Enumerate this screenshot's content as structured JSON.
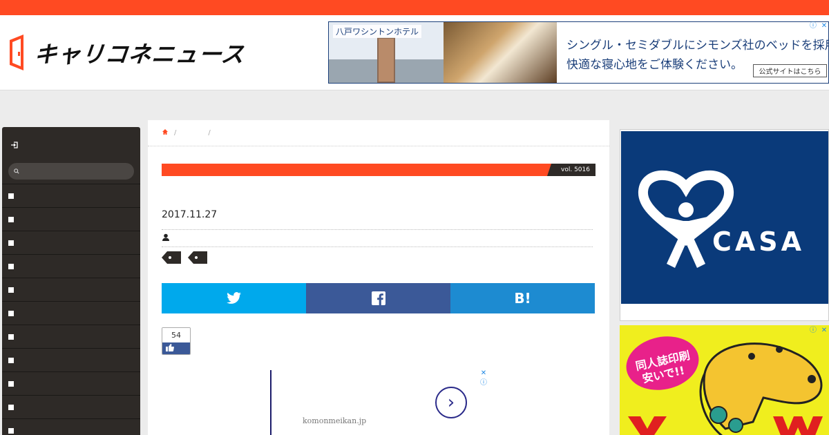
{
  "header": {
    "logo_text": "キャリコネニュース",
    "brand_color": "#ff4a22"
  },
  "top_ad": {
    "hotel_name": "八戸ワシントンホテル",
    "line1": "シングル・セミダブルにシモンズ社のベッドを採用。",
    "line2": "快適な寝心地をご体験ください。",
    "cta": "公式サイトはこちら",
    "info_icon": "info-icon",
    "close_icon": "close-icon"
  },
  "sidebar": {
    "login_icon": "login-icon",
    "search_icon": "search-icon",
    "item_count_icon": "square-bullet-icon",
    "items": [
      "",
      "",
      "",
      "",
      "",
      "",
      "",
      "",
      "",
      "",
      ""
    ]
  },
  "breadcrumb": {
    "home_icon": "home-icon",
    "separator": "/"
  },
  "article": {
    "vol": "vol. 5016",
    "date": "2017.11.27",
    "author_icon": "user-icon",
    "tag_icon": "tag-icon"
  },
  "share": {
    "twitter": "twitter-icon",
    "facebook": "facebook-icon",
    "hatena": "B!",
    "colors": {
      "twitter": "#00a9ec",
      "facebook": "#3b5998",
      "hatena": "#1d8bd1"
    }
  },
  "like": {
    "count": "54"
  },
  "mid_ad": {
    "domain": "komonmeikan.jp",
    "arrow_icon": "chevron-right-icon"
  },
  "right_ads": {
    "casa_text": "CASA",
    "print_line1": "同人誌印刷",
    "print_line2": "安いで!!"
  }
}
